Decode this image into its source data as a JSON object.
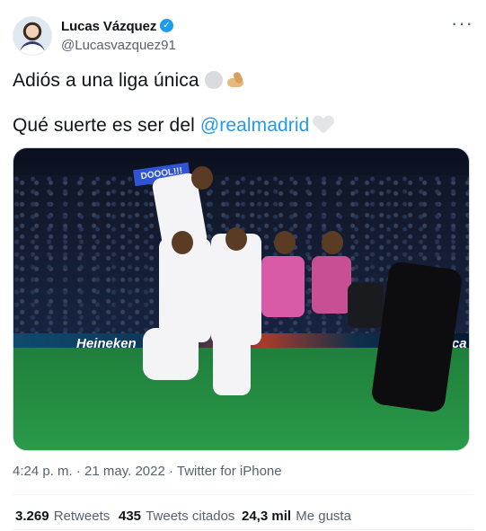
{
  "author": {
    "display_name": "Lucas Vázquez",
    "handle": "@Lucasvazquez91",
    "verified": true
  },
  "header": {
    "more_icon": "more-horizontal-icon"
  },
  "tweet": {
    "line1": "Adiós a una liga única",
    "line1_emojis": [
      "white-circle-emoji",
      "flexed-biceps-emoji"
    ],
    "line2_prefix": "Qué suerte es ser del ",
    "mention": "@realmadrid",
    "line2_emoji": "white-heart-emoji"
  },
  "media": {
    "sign_text": "DOOOL!!!",
    "ad_left": "Heineken",
    "ad_right": "asterca"
  },
  "meta": {
    "timestamp": "4:24 p. m. · 21 may. 2022",
    "separator": " · ",
    "source": "Twitter for iPhone"
  },
  "stats": {
    "retweets_count": "3.269",
    "retweets_label": "Retweets",
    "quotes_count": "435",
    "quotes_label": "Tweets citados",
    "likes_count": "24,3 mil",
    "likes_label": "Me gusta"
  }
}
